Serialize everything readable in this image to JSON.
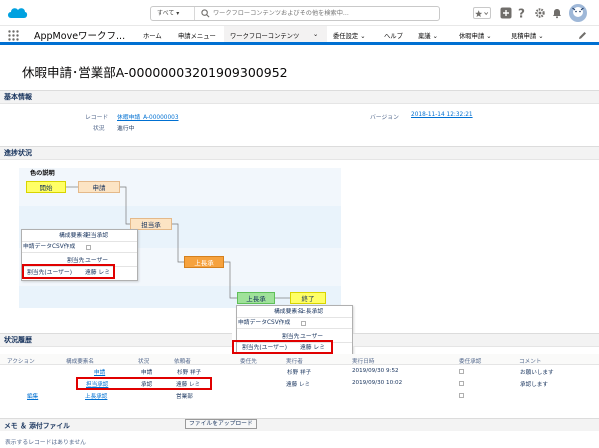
{
  "header": {
    "search_scope": "すべて ▾",
    "search_placeholder": "ワークフローコンテンツおよびその他を検索中...",
    "icons": [
      "star-icon",
      "add-icon",
      "help-icon",
      "gear-icon",
      "bell-icon",
      "avatar"
    ]
  },
  "nav": {
    "app_name": "AppMoveワークフ...",
    "items": [
      {
        "label": "ホーム"
      },
      {
        "label": "申請メニュー"
      },
      {
        "label": "ワークフローコンテンツ"
      },
      {
        "label": "委任設定 ⌄"
      },
      {
        "label": "ヘルプ"
      },
      {
        "label": "稟議 ⌄"
      },
      {
        "label": "休暇申請 ⌄"
      },
      {
        "label": "見積申請 ⌄"
      }
    ],
    "active_chevron": "⌄"
  },
  "page_title": "休暇申請･営業部A-00000003201909300952",
  "basic_info": {
    "section_label": "基本情報",
    "record_label": "レコード",
    "record_value": "休暇申請_A-00000003",
    "version_label": "バージョン",
    "version_value": "2018-11-14 12:32:21",
    "status_label": "状況",
    "status_value": "進行中"
  },
  "progress": {
    "section_label": "進捗状況",
    "legend_title": "色の説明",
    "nodes": {
      "start": "開始",
      "apply": "申請",
      "tanto": "担当承",
      "joucho": "上長承",
      "joucho2": "上長承",
      "end": "終了"
    },
    "popup1": {
      "name_label": "構成要素名",
      "name_value": "担当承認",
      "csv_label": "申請データCSV作成",
      "dest_label": "割当先",
      "dest_value": "ユーザー",
      "user_label": "割当先(ユーザー)",
      "user_value": "遠藤 レミ"
    },
    "popup2": {
      "name_label": "構成要素名",
      "name_value": "上長承認",
      "csv_label": "申請データCSV作成",
      "dest_label": "割当先",
      "dest_value": "ユーザー",
      "user_label": "割当先(ユーザー)",
      "user_value": "遠藤 レミ"
    }
  },
  "history": {
    "section_label": "状況履歴",
    "columns": [
      "アクション",
      "構成要素名",
      "状況",
      "依頼者",
      "委任先",
      "実行者",
      "実行日時",
      "委任承認",
      "コメント"
    ],
    "rows": [
      {
        "action": "",
        "name": "申請",
        "status": "申請",
        "requester": "杉野 祥子",
        "delegate": "",
        "executor": "杉野 祥子",
        "date": "2019/09/30 9:52",
        "comment": "お願いします"
      },
      {
        "action": "",
        "name": "担当承認",
        "status": "承認",
        "requester": "遠藤 レミ",
        "delegate": "",
        "executor": "遠藤 レミ",
        "date": "2019/09/30 10:02",
        "comment": "承認します"
      },
      {
        "action": "編集",
        "name": "上長承認",
        "status": "",
        "requester": "営業部",
        "delegate": "",
        "executor": "",
        "date": "",
        "comment": ""
      }
    ]
  },
  "memo": {
    "section_label": "メモ ＆ 添付ファイル",
    "upload_button": "ファイルをアップロード",
    "empty_text": "表示するレコードはありません"
  },
  "colors": {
    "accent": "#0070d2",
    "start_node": "#ffff66",
    "apply_node": "#fce4c4",
    "active_node": "#f6a23e",
    "next_node": "#9fe29a",
    "highlight": "#e00000"
  }
}
